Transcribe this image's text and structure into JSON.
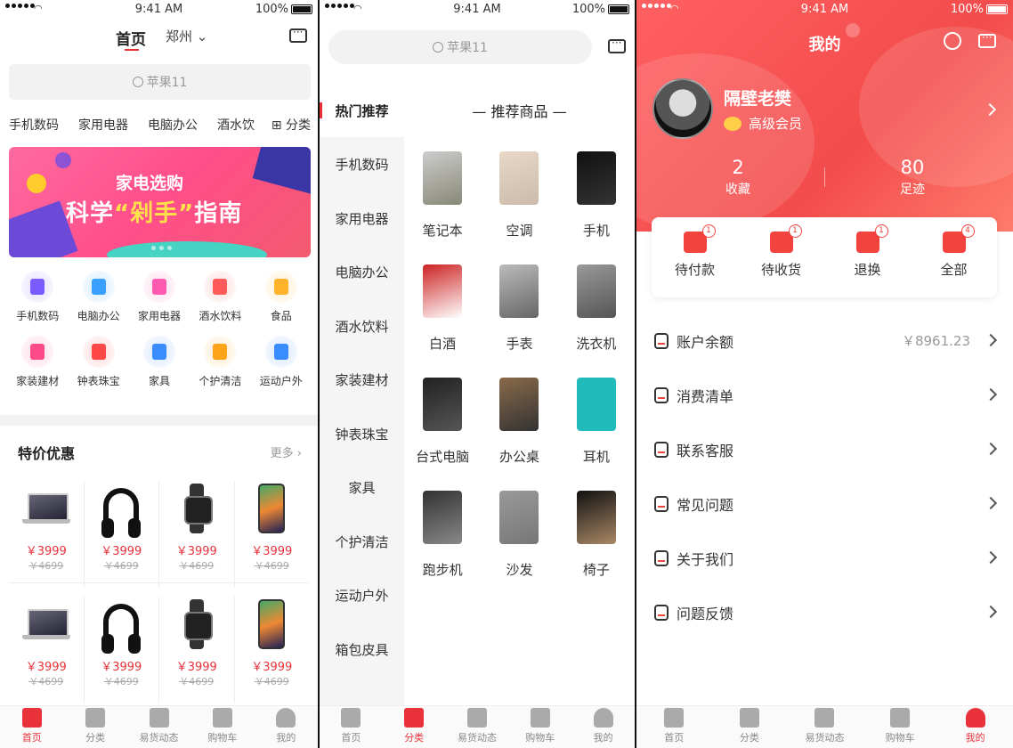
{
  "status": {
    "time": "9:41 AM",
    "battery": "100%"
  },
  "home": {
    "title": "首页",
    "city": "郑州",
    "search_placeholder": "苹果11",
    "categories": [
      "手机数码",
      "家用电器",
      "电脑办公",
      "酒水饮"
    ],
    "category_more": "分类",
    "banner": {
      "line1": "家电选购",
      "line2a": "科学",
      "line2b": "“剁手”",
      "line2c": "指南"
    },
    "grid": [
      {
        "label": "手机数码",
        "color": "#7b5cff"
      },
      {
        "label": "电脑办公",
        "color": "#3aa0ff"
      },
      {
        "label": "家用电器",
        "color": "#ff5ab0"
      },
      {
        "label": "酒水饮料",
        "color": "#ff5a5a"
      },
      {
        "label": "食品",
        "color": "#ffb32b"
      },
      {
        "label": "家装建材",
        "color": "#ff4a8a"
      },
      {
        "label": "钟表珠宝",
        "color": "#ff4848"
      },
      {
        "label": "家具",
        "color": "#3a8cff"
      },
      {
        "label": "个护清洁",
        "color": "#ffa31a"
      },
      {
        "label": "运动户外",
        "color": "#3a8cff"
      }
    ],
    "deals": {
      "title": "特价优惠",
      "more": "更多",
      "rows": [
        [
          {
            "shape": "laptop",
            "price": "￥3999",
            "old": "￥4699"
          },
          {
            "shape": "headphones",
            "price": "￥3999",
            "old": "￥4699"
          },
          {
            "shape": "watch",
            "price": "￥3999",
            "old": "￥4699"
          },
          {
            "shape": "phone",
            "price": "￥3999",
            "old": "￥4699"
          }
        ],
        [
          {
            "shape": "laptop",
            "price": "￥3999",
            "old": "￥4699"
          },
          {
            "shape": "headphones",
            "price": "￥3999",
            "old": "￥4699"
          },
          {
            "shape": "watch",
            "price": "￥3999",
            "old": "￥4699"
          },
          {
            "shape": "phone",
            "price": "￥3999",
            "old": "￥4699"
          }
        ]
      ]
    }
  },
  "category": {
    "search_placeholder": "苹果11",
    "left_nav": [
      "热门推荐",
      "手机数码",
      "家用电器",
      "电脑办公",
      "酒水饮料",
      "家装建材",
      "钟表珠宝",
      "家具",
      "个护清洁",
      "运动户外",
      "箱包皮具"
    ],
    "section_title": "推荐商品",
    "items": [
      "笔记本",
      "空调",
      "手机",
      "白酒",
      "手表",
      "洗衣机",
      "台式电脑",
      "办公桌",
      "耳机",
      "跑步机",
      "沙发",
      "椅子"
    ]
  },
  "mine": {
    "title": "我的",
    "username": "隔壁老樊",
    "member": "高级会员",
    "stats": [
      {
        "value": "2",
        "label": "收藏"
      },
      {
        "value": "80",
        "label": "足迹"
      }
    ],
    "orders": [
      {
        "label": "待付款",
        "badge": "1"
      },
      {
        "label": "待收货",
        "badge": "1"
      },
      {
        "label": "退换",
        "badge": "1"
      },
      {
        "label": "全部",
        "badge": "4"
      }
    ],
    "menu": [
      {
        "label": "账户余额",
        "value": "￥8961.23"
      },
      {
        "label": "消费清单",
        "value": ""
      },
      {
        "label": "联系客服",
        "value": ""
      },
      {
        "label": "常见问题",
        "value": ""
      },
      {
        "label": "关于我们",
        "value": ""
      },
      {
        "label": "问题反馈",
        "value": ""
      }
    ]
  },
  "tabbar": [
    "首页",
    "分类",
    "易货动态",
    "购物车",
    "我的"
  ],
  "colors": {
    "accent": "#e9323a"
  }
}
